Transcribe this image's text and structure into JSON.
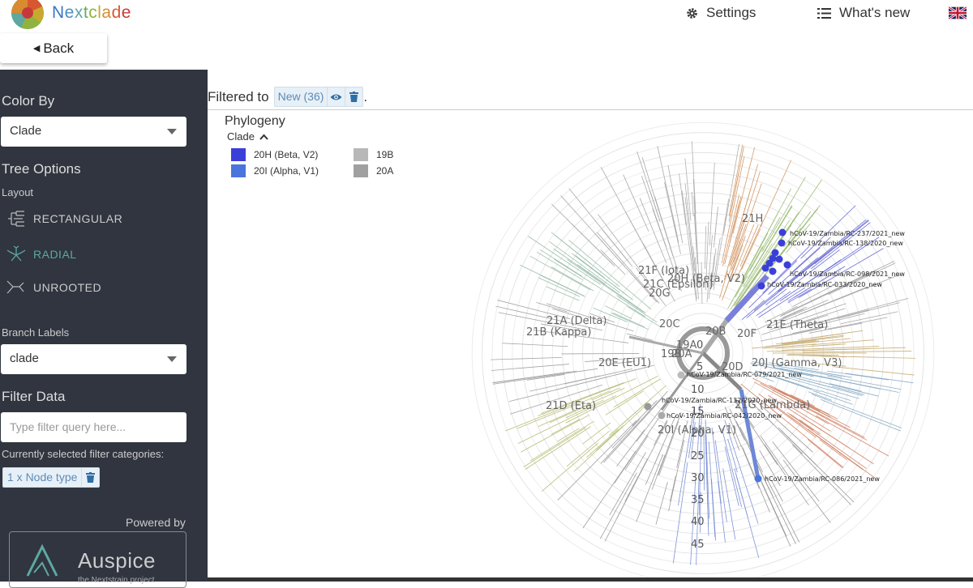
{
  "app": {
    "brand": "Nextclade",
    "brand_colors": [
      "#3b76c4",
      "#4a8ec8",
      "#5fa8a0",
      "#6aaa5a",
      "#8fb33e",
      "#c8a92f",
      "#d98b2f",
      "#d9572f",
      "#c43a3a"
    ]
  },
  "header": {
    "settings_label": "Settings",
    "whats_new_label": "What's new",
    "settings_icon": "gear-icon",
    "whats_new_icon": "list-icon",
    "language_icon": "uk-flag-icon"
  },
  "back_label": "Back",
  "sidebar": {
    "color_by_heading": "Color By",
    "color_by_value": "Clade",
    "tree_options_heading": "Tree Options",
    "layout_label": "Layout",
    "layouts": [
      {
        "label": "RECTANGULAR",
        "active": false
      },
      {
        "label": "RADIAL",
        "active": true
      },
      {
        "label": "UNROOTED",
        "active": false
      }
    ],
    "branch_labels_label": "Branch Labels",
    "branch_labels_value": "clade",
    "filter_heading": "Filter Data",
    "filter_placeholder": "Type filter query here...",
    "selected_categories_label": "Currently selected filter categories:",
    "selected_chip": "1 x Node type",
    "powered_by": "Powered by",
    "auspice_name": "Auspice",
    "auspice_tag": "the Nextstrain project"
  },
  "main": {
    "filtered_to": "Filtered to",
    "filter_chip": "New (36)",
    "filter_period": ".",
    "panel_title": "Phylogeny",
    "legend_title": "Clade",
    "legend": [
      {
        "label": "20H (Beta, V2)",
        "color": "#3a3fd9"
      },
      {
        "label": "20I (Alpha, V1)",
        "color": "#4a75dd"
      },
      {
        "label": "19B",
        "color": "#b8b8b8"
      },
      {
        "label": "20A",
        "color": "#a0a0a0"
      }
    ],
    "tree": {
      "clade_labels": [
        "21H",
        "21F (Iota)",
        "20H (Beta, V2)",
        "21C (Epsilon)",
        "20G",
        "21A (Delta)",
        "21B (Kappa)",
        "20C",
        "20B",
        "20F",
        "21E (Theta)",
        "19A",
        "20A",
        "19B",
        "20E (EU1)",
        "20D",
        "20J (Gamma, V3)",
        "21D (Eta)",
        "21G (Lambda)",
        "20I (Alpha, V1)"
      ],
      "scale_labels": [
        "0",
        "5",
        "10",
        "15",
        "20",
        "25",
        "30",
        "35",
        "40",
        "45"
      ],
      "tip_labels": [
        "hCoV-19/Zambia/RC-237/2021_new",
        "hCoV-19/Zambia/RC-138/2020_new",
        "hCoV-19/Zambia/RC-098/2021_new",
        "hCoV-19/Zambia/RC-033/2020_new",
        "hCoV-19/Zambia/RC-079/2021_new",
        "hCoV-19/Zambia/RC-132/2020_new",
        "hCoV-19/Zambia/RC-042/2020_new",
        "hCoV-19/Zambia/RC-086/2021_new"
      ]
    }
  }
}
